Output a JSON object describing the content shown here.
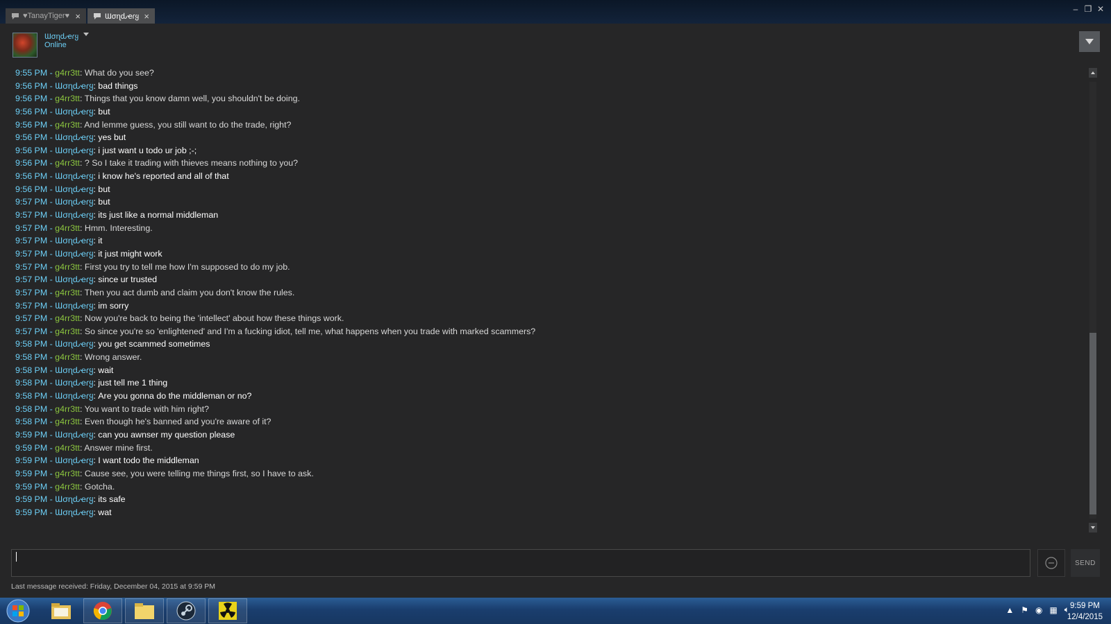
{
  "tabs": [
    {
      "label": "♥TanayTiger♥",
      "active": false
    },
    {
      "label": "Ɯσɳԃҽɾყ",
      "active": true
    }
  ],
  "header": {
    "friend_name": "Ɯσɳԃҽɾყ",
    "status": "Online"
  },
  "messages": [
    {
      "time": "9:55 PM",
      "sender": "g4rr3tt",
      "mine": true,
      "text": "What do you see?"
    },
    {
      "time": "9:56 PM",
      "sender": "Ɯσɳԃҽɾყ",
      "mine": false,
      "text": "bad things"
    },
    {
      "time": "9:56 PM",
      "sender": "g4rr3tt",
      "mine": true,
      "text": "Things that you know damn well, you shouldn't be doing."
    },
    {
      "time": "9:56 PM",
      "sender": "Ɯσɳԃҽɾყ",
      "mine": false,
      "text": "but"
    },
    {
      "time": "9:56 PM",
      "sender": "g4rr3tt",
      "mine": true,
      "text": "And lemme guess, you still want to do the trade, right?"
    },
    {
      "time": "9:56 PM",
      "sender": "Ɯσɳԃҽɾყ",
      "mine": false,
      "text": "yes but"
    },
    {
      "time": "9:56 PM",
      "sender": "Ɯσɳԃҽɾყ",
      "mine": false,
      "text": "i just want u todo ur job ;-;"
    },
    {
      "time": "9:56 PM",
      "sender": "g4rr3tt",
      "mine": true,
      "text": "? So I take it trading with thieves means nothing to you?"
    },
    {
      "time": "9:56 PM",
      "sender": "Ɯσɳԃҽɾყ",
      "mine": false,
      "text": "i know he's reported and all of that"
    },
    {
      "time": "9:56 PM",
      "sender": "Ɯσɳԃҽɾყ",
      "mine": false,
      "text": "but"
    },
    {
      "time": "9:57 PM",
      "sender": "Ɯσɳԃҽɾყ",
      "mine": false,
      "text": "but"
    },
    {
      "time": "9:57 PM",
      "sender": "Ɯσɳԃҽɾყ",
      "mine": false,
      "text": "its just like a normal middleman"
    },
    {
      "time": "9:57 PM",
      "sender": "g4rr3tt",
      "mine": true,
      "text": "Hmm. Interesting."
    },
    {
      "time": "9:57 PM",
      "sender": "Ɯσɳԃҽɾყ",
      "mine": false,
      "text": "it"
    },
    {
      "time": "9:57 PM",
      "sender": "Ɯσɳԃҽɾყ",
      "mine": false,
      "text": "it just might work"
    },
    {
      "time": "9:57 PM",
      "sender": "g4rr3tt",
      "mine": true,
      "text": "First you try to tell me how I'm supposed to do my job."
    },
    {
      "time": "9:57 PM",
      "sender": "Ɯσɳԃҽɾყ",
      "mine": false,
      "text": "since ur trusted"
    },
    {
      "time": "9:57 PM",
      "sender": "g4rr3tt",
      "mine": true,
      "text": "Then you act dumb and claim you don't know the rules."
    },
    {
      "time": "9:57 PM",
      "sender": "Ɯσɳԃҽɾყ",
      "mine": false,
      "text": "im sorry"
    },
    {
      "time": "9:57 PM",
      "sender": "g4rr3tt",
      "mine": true,
      "text": "Now you're back to being the 'intellect' about how these things work."
    },
    {
      "time": "9:57 PM",
      "sender": "g4rr3tt",
      "mine": true,
      "text": "So since you're so 'enlightened' and I'm a fucking idiot, tell me, what happens when you trade with marked scammers?"
    },
    {
      "time": "9:58 PM",
      "sender": "Ɯσɳԃҽɾყ",
      "mine": false,
      "text": "you get scammed sometimes"
    },
    {
      "time": "9:58 PM",
      "sender": "g4rr3tt",
      "mine": true,
      "text": "Wrong answer."
    },
    {
      "time": "9:58 PM",
      "sender": "Ɯσɳԃҽɾყ",
      "mine": false,
      "text": "wait"
    },
    {
      "time": "9:58 PM",
      "sender": "Ɯσɳԃҽɾყ",
      "mine": false,
      "text": "just tell me 1 thing"
    },
    {
      "time": "9:58 PM",
      "sender": "Ɯσɳԃҽɾყ",
      "mine": false,
      "text": "Are you gonna do the middleman or no?"
    },
    {
      "time": "9:58 PM",
      "sender": "g4rr3tt",
      "mine": true,
      "text": "You want to trade with him right?"
    },
    {
      "time": "9:58 PM",
      "sender": "g4rr3tt",
      "mine": true,
      "text": "Even though he's banned and you're aware of it?"
    },
    {
      "time": "9:59 PM",
      "sender": "Ɯσɳԃҽɾყ",
      "mine": false,
      "text": "can you awnser my question please"
    },
    {
      "time": "9:59 PM",
      "sender": "g4rr3tt",
      "mine": true,
      "text": "Answer mine first."
    },
    {
      "time": "9:59 PM",
      "sender": "Ɯσɳԃҽɾყ",
      "mine": false,
      "text": "I want todo the middleman"
    },
    {
      "time": "9:59 PM",
      "sender": "g4rr3tt",
      "mine": true,
      "text": "Cause see, you were telling me things first, so I have to ask."
    },
    {
      "time": "9:59 PM",
      "sender": "g4rr3tt",
      "mine": true,
      "text": "Gotcha."
    },
    {
      "time": "9:59 PM",
      "sender": "Ɯσɳԃҽɾყ",
      "mine": false,
      "text": "its safe"
    },
    {
      "time": "9:59 PM",
      "sender": "Ɯσɳԃҽɾყ",
      "mine": false,
      "text": "wat"
    }
  ],
  "composer": {
    "value": "",
    "send_label": "SEND"
  },
  "footer": {
    "last_message": "Last message received: Friday, December 04, 2015 at 9:59 PM"
  },
  "taskbar": {
    "apps": [
      "windows-explorer",
      "google-chrome",
      "folder",
      "steam",
      "radiation-app"
    ],
    "time": "9:59 PM",
    "date": "12/4/2015"
  },
  "colors": {
    "timestamp": "#6dcff6",
    "friend_name": "#6dcff6",
    "my_name": "#8bc53f",
    "friend_text": "#ffffff",
    "my_text": "#d8d8d8",
    "background": "#262627"
  }
}
